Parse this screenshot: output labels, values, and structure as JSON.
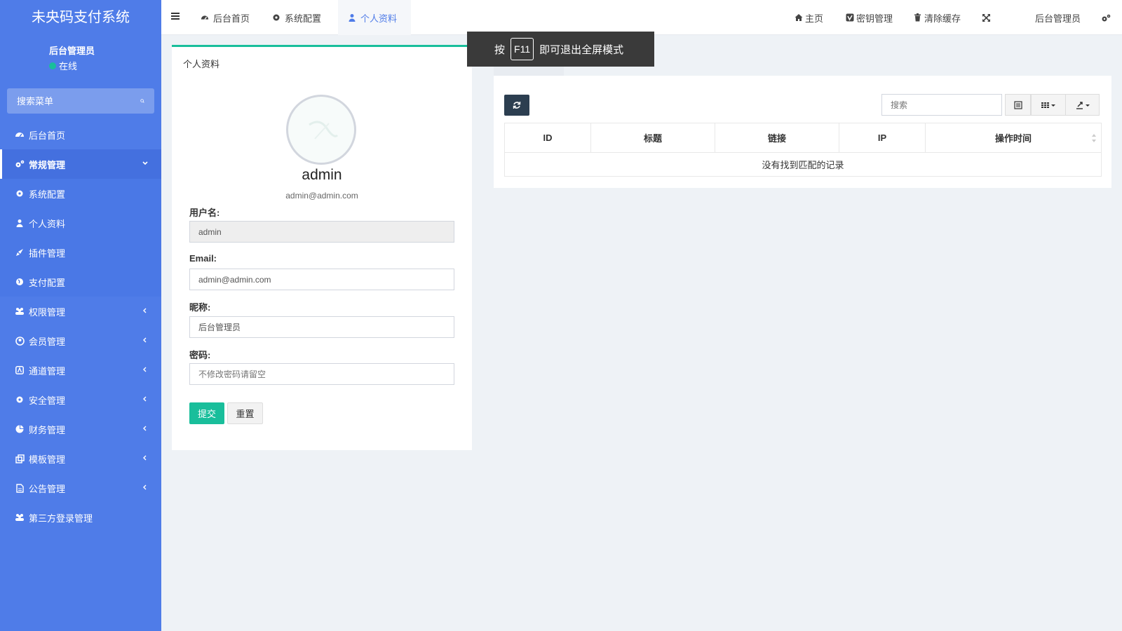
{
  "app": {
    "title": "未央码支付系统"
  },
  "user_panel": {
    "name": "后台管理员",
    "status": "在线"
  },
  "sidebar": {
    "search_placeholder": "搜索菜单",
    "items": [
      {
        "label": "后台首页",
        "icon": "dashboard-icon"
      },
      {
        "label": "常规管理",
        "icon": "cogs-icon",
        "state": "open"
      },
      {
        "label": "系统配置",
        "icon": "gear-icon",
        "sub": true
      },
      {
        "label": "个人资料",
        "icon": "user-icon",
        "sub": true,
        "active": true
      },
      {
        "label": "插件管理",
        "icon": "rocket-icon",
        "sub": true
      },
      {
        "label": "支付配置",
        "icon": "globe-icon",
        "sub": true
      },
      {
        "label": "权限管理",
        "icon": "group-icon"
      },
      {
        "label": "会员管理",
        "icon": "user-circle-icon"
      },
      {
        "label": "通道管理",
        "icon": "app-store-icon"
      },
      {
        "label": "安全管理",
        "icon": "gear-icon"
      },
      {
        "label": "财务管理",
        "icon": "pie-chart-icon"
      },
      {
        "label": "模板管理",
        "icon": "clone-icon"
      },
      {
        "label": "公告管理",
        "icon": "file-text-icon"
      },
      {
        "label": "第三方登录管理",
        "icon": "group-icon"
      }
    ]
  },
  "header": {
    "tabs": [
      {
        "label": "后台首页",
        "icon": "dashboard-icon"
      },
      {
        "label": "系统配置",
        "icon": "gear-icon"
      },
      {
        "label": "个人资料",
        "icon": "user-icon",
        "active": true
      }
    ],
    "right": {
      "home": "主页",
      "keys": "密钥管理",
      "clear_cache": "清除缓存",
      "admin": "后台管理员"
    }
  },
  "profile": {
    "panel_title": "个人资料",
    "display_name": "admin",
    "display_email": "admin@admin.com",
    "form": {
      "username_label": "用户名:",
      "username_value": "admin",
      "email_label": "Email:",
      "email_value": "admin@admin.com",
      "nickname_label": "昵称:",
      "nickname_value": "后台管理员",
      "password_label": "密码:",
      "password_placeholder": "不修改密码请留空",
      "submit": "提交",
      "reset": "重置"
    }
  },
  "logs": {
    "search_placeholder": "搜索",
    "columns": [
      "ID",
      "标题",
      "链接",
      "IP",
      "操作时间"
    ],
    "empty_text": "没有找到匹配的记录"
  },
  "toast": {
    "before": "按",
    "key": "F11",
    "after": "即可退出全屏模式"
  },
  "colors": {
    "sidebar": "#4f7ce8",
    "accent": "#19be9b",
    "dark_button": "#2c3e50"
  }
}
